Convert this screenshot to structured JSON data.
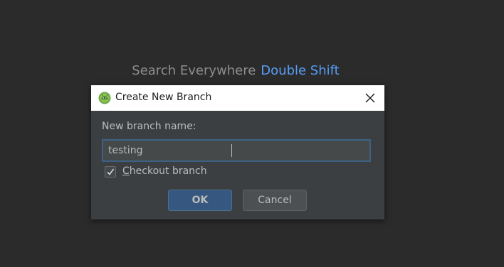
{
  "background_hint": {
    "text": "Search Everywhere",
    "shortcut": "Double Shift"
  },
  "dialog": {
    "title": "Create New Branch",
    "app_icon": "android-studio-icon",
    "close_icon": "close-icon",
    "field_label": "New branch name:",
    "branch_name_value": "testing",
    "checkbox": {
      "checked": true,
      "label_mnemonic": "C",
      "label_rest": "heckout branch"
    },
    "ok_label": "OK",
    "cancel_label": "Cancel"
  },
  "colors": {
    "background": "#2b2b2b",
    "dialog_bg": "#3c3f41",
    "accent_link": "#589df6",
    "ok_button": "#365880",
    "input_focus_border": "#3d6185"
  }
}
